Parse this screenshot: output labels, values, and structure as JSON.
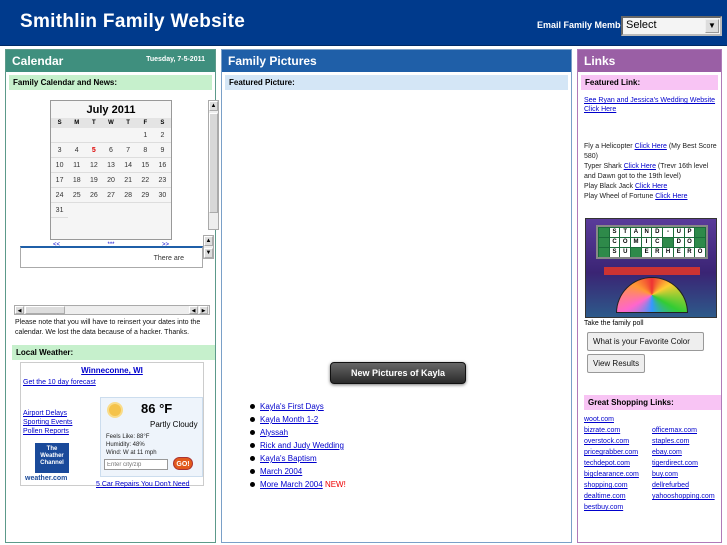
{
  "header": {
    "title": "Smithlin Family Website",
    "email_label": "Email Family Member:",
    "email_select": "Select"
  },
  "calendar": {
    "heading": "Calendar",
    "date": "Tuesday, 7-5-2011",
    "subheading": "Family Calendar and News:",
    "month": "July 2011",
    "days_of_week": [
      "S",
      "M",
      "T",
      "W",
      "T",
      "F",
      "S"
    ],
    "days": [
      "",
      "",
      "",
      "",
      "",
      "1",
      "2",
      "3",
      "4",
      "5",
      "6",
      "7",
      "8",
      "9",
      "10",
      "11",
      "12",
      "13",
      "14",
      "15",
      "16",
      "17",
      "18",
      "19",
      "20",
      "21",
      "22",
      "23",
      "24",
      "25",
      "26",
      "27",
      "28",
      "29",
      "30",
      "31"
    ],
    "today": "5",
    "prev_label": "<<",
    "today_link": "***",
    "next_label": ">>",
    "there_are_text": "There are",
    "note": "Please note that you will have to reinsert your dates into the calendar. We lost the data because of a hacker. Thanks."
  },
  "weather": {
    "heading": "Local Weather:",
    "city": "Winneconne, WI",
    "forecast_link": "Get the 10 day forecast",
    "links": [
      "Airport Delays",
      "Sporting Events",
      "Pollen Reports"
    ],
    "logo": "The Weather Channel",
    "logo_url": "weather.com",
    "temp": "86 °F",
    "condition": "Partly Cloudy",
    "feels_like": "Feels Like: 88°F",
    "humidity": "Humidity: 48%",
    "wind": "Wind: W at 11 mph",
    "input_placeholder": "Enter city/zip",
    "go_label": "GO!",
    "ad_link": "5 Car Repairs You Don't Need"
  },
  "pictures": {
    "heading": "Family Pictures",
    "subheading": "Featured Picture:",
    "button_label": "New Pictures of Kayla",
    "links": [
      "Kayla's First Days",
      "Kayla Month 1-2",
      "Alyssah",
      "Rick and Judy Wedding",
      "Kayla's Baptism",
      "March 2004",
      "More March 2004"
    ],
    "new_tag": "NEW!"
  },
  "links": {
    "heading": "Links",
    "featured_head": "Featured Link:",
    "featured_text": "See Ryan and Jessica's Wedding Website",
    "featured_click": "Click Here",
    "games": [
      {
        "before": "Fly a Helicopter ",
        "link": "Click Here",
        "after": " (My Best Score 580)"
      },
      {
        "before": "Typer Shark ",
        "link": "Click Here",
        "after": " (Trevr 16th level and Dawn got to the 19th level)"
      },
      {
        "before": "Play Black Jack ",
        "link": "Click Here",
        "after": ""
      },
      {
        "before": "Play Wheel of Fortune ",
        "link": "Click Here",
        "after": ""
      }
    ],
    "wof_board": [
      "",
      "S",
      "T",
      "A",
      "N",
      "D",
      "-",
      "U",
      "P",
      "",
      "",
      "C",
      "O",
      "M",
      "I",
      "C",
      "",
      "D",
      "O",
      "",
      "",
      "S",
      "U",
      "",
      "E",
      "R",
      "H",
      "E",
      "R",
      "O"
    ],
    "poll_text": "Take the family poll",
    "poll_button": "What is your Favorite Color",
    "results_button": "View Results",
    "shopping_head": "Great Shopping Links:",
    "shopping": [
      "woot.com",
      "",
      "bizrate.com",
      "officemax.com",
      "overstock.com",
      "staples.com",
      "pricegrabber.com",
      "ebay.com",
      "techdepot.com",
      "tigerdirect.com",
      "bigclearance.com",
      "buy.com",
      "shopping.com",
      "dellrefurbed",
      "dealtime.com",
      "yahooshopping.com",
      "bestbuy.com",
      ""
    ]
  }
}
